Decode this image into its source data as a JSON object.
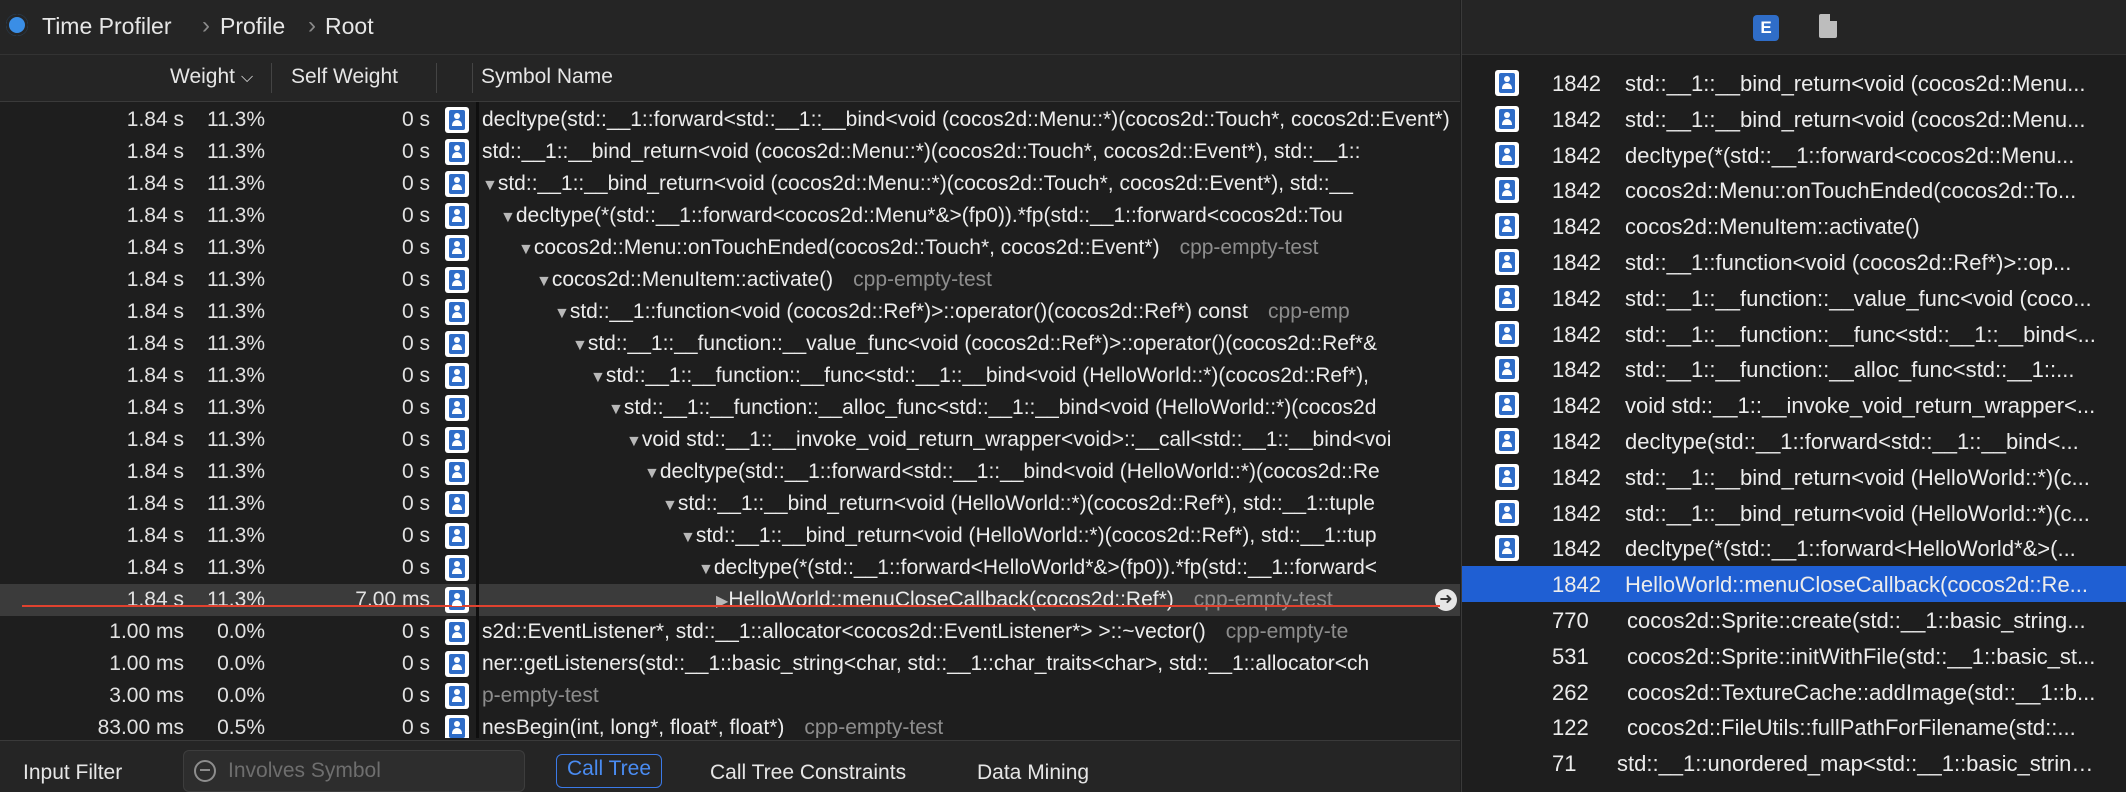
{
  "breadcrumb": [
    "Time Profiler",
    "Profile",
    "Root"
  ],
  "columns": {
    "weight": "Weight",
    "self_weight": "Self Weight",
    "symbol": "Symbol Name"
  },
  "rows": [
    {
      "time": "1.84 s",
      "pct": "11.3%",
      "self": "0 s",
      "indent": 0,
      "tri": "",
      "sym": "decltype(std::__1::forward<std::__1::__bind<void (cocos2d::Menu::*)(cocos2d::Touch*, cocos2d::Event*)",
      "lib": ""
    },
    {
      "time": "1.84 s",
      "pct": "11.3%",
      "self": "0 s",
      "indent": 0,
      "tri": "",
      "sym": "std::__1::__bind_return<void (cocos2d::Menu::*)(cocos2d::Touch*, cocos2d::Event*), std::__1::",
      "lib": ""
    },
    {
      "time": "1.84 s",
      "pct": "11.3%",
      "self": "0 s",
      "indent": 0,
      "tri": "▼",
      "sym": "std::__1::__bind_return<void (cocos2d::Menu::*)(cocos2d::Touch*, cocos2d::Event*), std::__",
      "lib": ""
    },
    {
      "time": "1.84 s",
      "pct": "11.3%",
      "self": "0 s",
      "indent": 1,
      "tri": "▼",
      "sym": "decltype(*(std::__1::forward<cocos2d::Menu*&>(fp0)).*fp(std::__1::forward<cocos2d::Tou",
      "lib": ""
    },
    {
      "time": "1.84 s",
      "pct": "11.3%",
      "self": "0 s",
      "indent": 2,
      "tri": "▼",
      "sym": "cocos2d::Menu::onTouchEnded(cocos2d::Touch*, cocos2d::Event*)",
      "lib": "cpp-empty-test"
    },
    {
      "time": "1.84 s",
      "pct": "11.3%",
      "self": "0 s",
      "indent": 3,
      "tri": "▼",
      "sym": "cocos2d::MenuItem::activate()",
      "lib": "cpp-empty-test"
    },
    {
      "time": "1.84 s",
      "pct": "11.3%",
      "self": "0 s",
      "indent": 4,
      "tri": "▼",
      "sym": "std::__1::function<void (cocos2d::Ref*)>::operator()(cocos2d::Ref*) const",
      "lib": "cpp-emp"
    },
    {
      "time": "1.84 s",
      "pct": "11.3%",
      "self": "0 s",
      "indent": 5,
      "tri": "▼",
      "sym": "std::__1::__function::__value_func<void (cocos2d::Ref*)>::operator()(cocos2d::Ref*&",
      "lib": ""
    },
    {
      "time": "1.84 s",
      "pct": "11.3%",
      "self": "0 s",
      "indent": 6,
      "tri": "▼",
      "sym": "std::__1::__function::__func<std::__1::__bind<void (HelloWorld::*)(cocos2d::Ref*),",
      "lib": ""
    },
    {
      "time": "1.84 s",
      "pct": "11.3%",
      "self": "0 s",
      "indent": 7,
      "tri": "▼",
      "sym": "std::__1::__function::__alloc_func<std::__1::__bind<void (HelloWorld::*)(cocos2d",
      "lib": ""
    },
    {
      "time": "1.84 s",
      "pct": "11.3%",
      "self": "0 s",
      "indent": 8,
      "tri": "▼",
      "sym": "void std::__1::__invoke_void_return_wrapper<void>::__call<std::__1::__bind<voi",
      "lib": ""
    },
    {
      "time": "1.84 s",
      "pct": "11.3%",
      "self": "0 s",
      "indent": 9,
      "tri": "▼",
      "sym": "decltype(std::__1::forward<std::__1::__bind<void (HelloWorld::*)(cocos2d::Re",
      "lib": ""
    },
    {
      "time": "1.84 s",
      "pct": "11.3%",
      "self": "0 s",
      "indent": 10,
      "tri": "▼",
      "sym": "std::__1::__bind_return<void (HelloWorld::*)(cocos2d::Ref*), std::__1::tuple",
      "lib": ""
    },
    {
      "time": "1.84 s",
      "pct": "11.3%",
      "self": "0 s",
      "indent": 11,
      "tri": "▼",
      "sym": "std::__1::__bind_return<void (HelloWorld::*)(cocos2d::Ref*), std::__1::tup",
      "lib": ""
    },
    {
      "time": "1.84 s",
      "pct": "11.3%",
      "self": "0 s",
      "indent": 12,
      "tri": "▼",
      "sym": "decltype(*(std::__1::forward<HelloWorld*&>(fp0)).*fp(std::__1::forward<",
      "lib": ""
    },
    {
      "time": "1.84 s",
      "pct": "11.3%",
      "self": "7.00 ms",
      "indent": 13,
      "tri": "▶",
      "sym": "HelloWorld::menuCloseCallback(cocos2d::Ref*)",
      "lib": "cpp-empty-test",
      "selected": true
    },
    {
      "time": "1.00 ms",
      "pct": "0.0%",
      "self": "0 s",
      "indent": 0,
      "tri": "",
      "sym": "s2d::EventListener*, std::__1::allocator<cocos2d::EventListener*> >::~vector()",
      "lib": "cpp-empty-te"
    },
    {
      "time": "1.00 ms",
      "pct": "0.0%",
      "self": "0 s",
      "indent": 0,
      "tri": "",
      "sym": "ner::getListeners(std::__1::basic_string<char, std::__1::char_traits<char>, std::__1::allocator<ch",
      "lib": ""
    },
    {
      "time": "3.00 ms",
      "pct": "0.0%",
      "self": "0 s",
      "indent": 0,
      "tri": "",
      "sym": "",
      "lib": "p-empty-test"
    },
    {
      "time": "83.00 ms",
      "pct": "0.5%",
      "self": "0 s",
      "indent": 0,
      "tri": "",
      "sym": "nesBegin(int, long*, float*, float*)",
      "lib": "cpp-empty-test"
    }
  ],
  "bottom": {
    "input_filter": "Input Filter",
    "search_placeholder": "Involves Symbol",
    "tab_call_tree": "Call Tree",
    "tab_constraints": "Call Tree Constraints",
    "tab_data_mining": "Data Mining"
  },
  "right_tabs": {
    "extended": "E"
  },
  "right_rows": [
    {
      "count": "1842",
      "sym": "std::__1::__bind_return<void (cocos2d::Menu...",
      "icon": true
    },
    {
      "count": "1842",
      "sym": "std::__1::__bind_return<void (cocos2d::Menu...",
      "icon": true
    },
    {
      "count": "1842",
      "sym": "decltype(*(std::__1::forward<cocos2d::Menu...",
      "icon": true
    },
    {
      "count": "1842",
      "sym": "cocos2d::Menu::onTouchEnded(cocos2d::To...",
      "icon": true
    },
    {
      "count": "1842",
      "sym": "cocos2d::MenuItem::activate()",
      "icon": true
    },
    {
      "count": "1842",
      "sym": "std::__1::function<void (cocos2d::Ref*)>::op...",
      "icon": true
    },
    {
      "count": "1842",
      "sym": "std::__1::__function::__value_func<void (coco...",
      "icon": true
    },
    {
      "count": "1842",
      "sym": "std::__1::__function::__func<std::__1::__bind<...",
      "icon": true
    },
    {
      "count": "1842",
      "sym": "std::__1::__function::__alloc_func<std::__1::...",
      "icon": true
    },
    {
      "count": "1842",
      "sym": "void std::__1::__invoke_void_return_wrapper<...",
      "icon": true
    },
    {
      "count": "1842",
      "sym": "decltype(std::__1::forward<std::__1::__bind<...",
      "icon": true
    },
    {
      "count": "1842",
      "sym": "std::__1::__bind_return<void (HelloWorld::*)(c...",
      "icon": true
    },
    {
      "count": "1842",
      "sym": "std::__1::__bind_return<void (HelloWorld::*)(c...",
      "icon": true
    },
    {
      "count": "1842",
      "sym": "decltype(*(std::__1::forward<HelloWorld*&>(...",
      "icon": true
    },
    {
      "count": "1842",
      "sym": "HelloWorld::menuCloseCallback(cocos2d::Re...",
      "icon": false,
      "selected": true
    },
    {
      "count": "770",
      "sym": "cocos2d::Sprite::create(std::__1::basic_string...",
      "icon": true
    },
    {
      "count": "531",
      "sym": "cocos2d::Sprite::initWithFile(std::__1::basic_st...",
      "icon": true
    },
    {
      "count": "262",
      "sym": "cocos2d::TextureCache::addImage(std::__1::b...",
      "icon": true
    },
    {
      "count": "122",
      "sym": "cocos2d::FileUtils::fullPathForFilename(std::...",
      "icon": true
    },
    {
      "count": "71",
      "sym": "std::__1::unordered_map<std::__1::basic_string...",
      "icon": true
    }
  ],
  "colors": {
    "accent": "#2f6dc8",
    "selection": "#1f5fd3",
    "marker": "#e0422f"
  }
}
